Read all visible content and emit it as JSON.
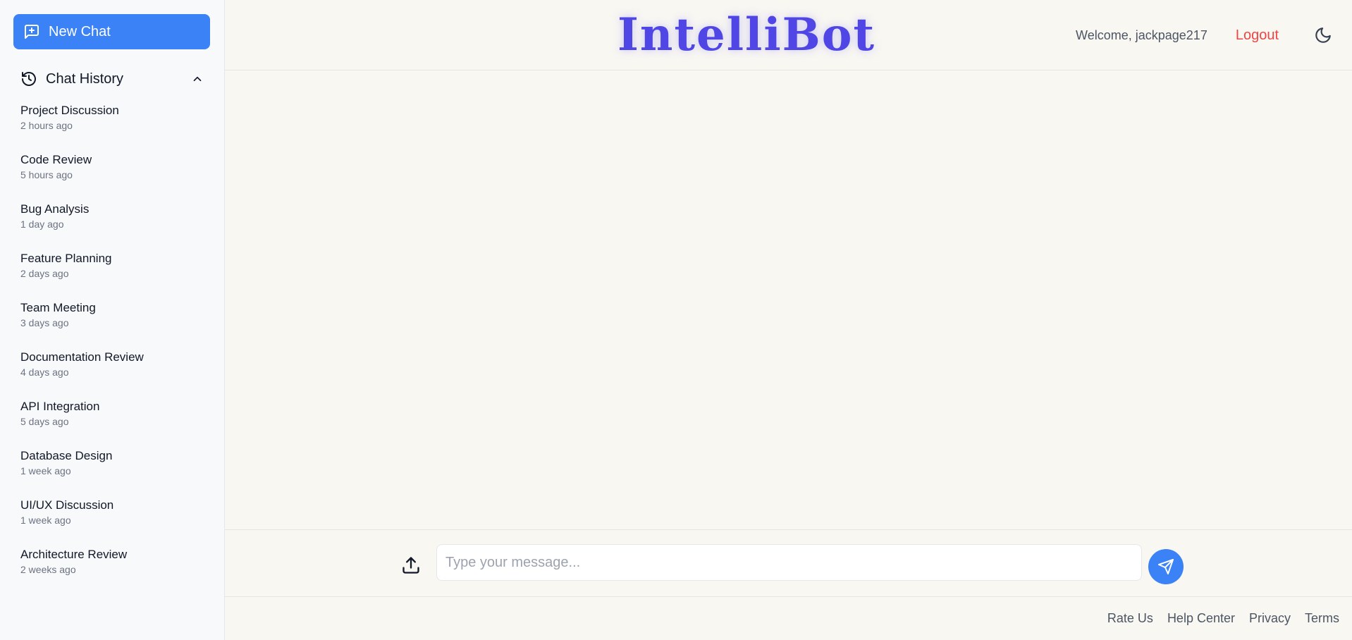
{
  "sidebar": {
    "new_chat_label": "New Chat",
    "history_title": "Chat History",
    "items": [
      {
        "name": "Project Discussion",
        "time": "2 hours ago"
      },
      {
        "name": "Code Review",
        "time": "5 hours ago"
      },
      {
        "name": "Bug Analysis",
        "time": "1 day ago"
      },
      {
        "name": "Feature Planning",
        "time": "2 days ago"
      },
      {
        "name": "Team Meeting",
        "time": "3 days ago"
      },
      {
        "name": "Documentation Review",
        "time": "4 days ago"
      },
      {
        "name": "API Integration",
        "time": "5 days ago"
      },
      {
        "name": "Database Design",
        "time": "1 week ago"
      },
      {
        "name": "UI/UX Discussion",
        "time": "1 week ago"
      },
      {
        "name": "Architecture Review",
        "time": "2 weeks ago"
      }
    ]
  },
  "header": {
    "logo": "IntelliBot",
    "welcome": "Welcome, jackpage217",
    "logout_label": "Logout"
  },
  "composer": {
    "placeholder": "Type your message..."
  },
  "footer": {
    "links": [
      "Rate Us",
      "Help Center",
      "Privacy",
      "Terms"
    ]
  },
  "colors": {
    "accent": "#3b82f6",
    "logo": "#4f46e5",
    "logout": "#ef4444",
    "background": "#f9f7f2"
  },
  "icons": {
    "new_chat": "message-plus-icon",
    "history": "history-icon",
    "collapse": "chevron-up-icon",
    "theme": "moon-icon",
    "upload": "upload-icon",
    "send": "send-icon"
  }
}
